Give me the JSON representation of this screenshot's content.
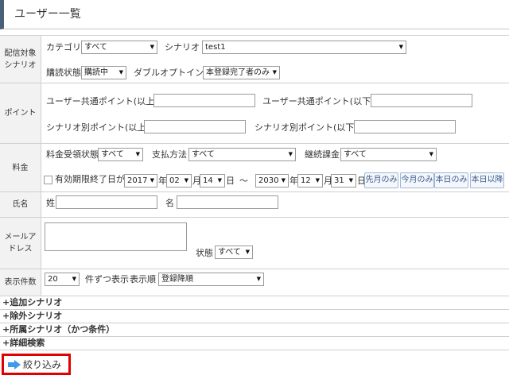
{
  "header": {
    "title": "ユーザー一覧"
  },
  "delivery_target": {
    "label": "配信対象シナリオ",
    "category_label": "カテゴリ",
    "category_value": "すべて",
    "scenario_label": "シナリオ",
    "scenario_value": "test1",
    "subscription_label": "購読状態",
    "subscription_value": "購読中",
    "double_optin_label": "ダブルオプトイン",
    "double_optin_value": "本登録完了者のみ"
  },
  "points": {
    "label": "ポイント",
    "common_min_label": "ユーザー共通ポイント(以上)",
    "common_max_label": "ユーザー共通ポイント(以下)",
    "scenario_min_label": "シナリオ別ポイント(以上)",
    "scenario_max_label": "シナリオ別ポイント(以下)",
    "common_min_value": "",
    "common_max_value": "",
    "scenario_min_value": "",
    "scenario_max_value": ""
  },
  "fee": {
    "label": "料金",
    "payment_status_label": "料金受領状態",
    "payment_status_value": "すべて",
    "payment_method_label": "支払方法",
    "payment_method_value": "すべて",
    "recurring_label": "継続課金",
    "recurring_value": "すべて",
    "expiry_label": "有効期限終了日が",
    "from_year": "2017",
    "from_month": "02",
    "from_day": "14",
    "to_year": "2030",
    "to_month": "12",
    "to_day": "31",
    "year_unit": "年",
    "month_unit": "月",
    "day_unit": "日",
    "tilde": "～",
    "btn_last_month": "先月のみ",
    "btn_this_month": "今月のみ",
    "btn_today": "本日のみ",
    "btn_after_today": "本日以降"
  },
  "name": {
    "label": "氏名",
    "last_label": "姓",
    "first_label": "名",
    "last_value": "",
    "first_value": ""
  },
  "email": {
    "label": "メールアドレス",
    "value": "",
    "status_label": "状態",
    "status_value": "すべて"
  },
  "display": {
    "label": "表示件数",
    "count_value": "20",
    "per_page_label": "件ずつ表示",
    "order_label": "表示順",
    "order_value": "登録降順"
  },
  "sections": [
    {
      "label": "+追加シナリオ"
    },
    {
      "label": "+除外シナリオ"
    },
    {
      "label": "+所属シナリオ（かつ条件）"
    },
    {
      "label": "+詳細検索"
    }
  ],
  "filter_button": {
    "label": "絞り込み",
    "icon": "arrow-right-icon"
  },
  "colors": {
    "accent": "#4a5f78",
    "highlight": "#e00000",
    "arrow": "#3d9be9"
  }
}
